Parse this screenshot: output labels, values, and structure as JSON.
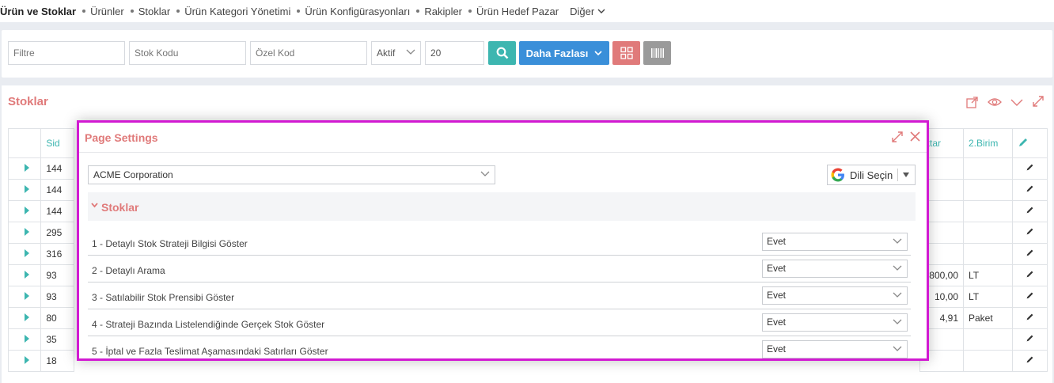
{
  "topnav": {
    "title": "Ürün ve Stoklar",
    "items": [
      "Ürünler",
      "Stoklar",
      "Ürün Kategori Yönetimi",
      "Ürün Konfigürasyonları",
      "Rakipler",
      "Ürün Hedef Pazar"
    ],
    "more": "Diğer"
  },
  "filters": {
    "filter_placeholder": "Filtre",
    "stock_code_placeholder": "Stok Kodu",
    "special_code_placeholder": "Özel Kod",
    "status_value": "Aktif",
    "page_size": "20",
    "more_label": "Daha Fazlası"
  },
  "stocks": {
    "title": "Stoklar",
    "headers": {
      "sid": "Sid",
      "qty": "ktar",
      "unit2": "2.Birim"
    },
    "sid_values": [
      "144",
      "144",
      "144",
      "295",
      "316",
      "93",
      "93",
      "80",
      "35",
      "18"
    ],
    "qty_values": [
      "",
      "",
      "",
      "",
      "",
      "800,00",
      "10,00",
      "4,91",
      "",
      ""
    ],
    "unit2_values": [
      "",
      "",
      "",
      "",
      "",
      "LT",
      "LT",
      "Paket",
      "",
      ""
    ]
  },
  "modal": {
    "title": "Page Settings",
    "company": "ACME Corporation",
    "language_button": "Dili Seçin",
    "section": "Stoklar",
    "settings": [
      {
        "label": "1 - Detaylı Stok Strateji Bilgisi Göster",
        "value": "Evet"
      },
      {
        "label": "2 - Detaylı Arama",
        "value": "Evet"
      },
      {
        "label": "3 - Satılabilir Stok Prensibi Göster",
        "value": "Evet"
      },
      {
        "label": "4 - Strateji Bazında Listelendiğinde Gerçek Stok Göster",
        "value": "Evet"
      },
      {
        "label": "5 - İptal ve Fazla Teslimat Aşamasındaki Satırları Göster",
        "value": "Evet"
      }
    ]
  },
  "colors": {
    "accent_teal": "#3db6b0",
    "accent_red": "#e07a7a",
    "accent_blue": "#3a8fd9",
    "highlight": "#d21ad2"
  }
}
